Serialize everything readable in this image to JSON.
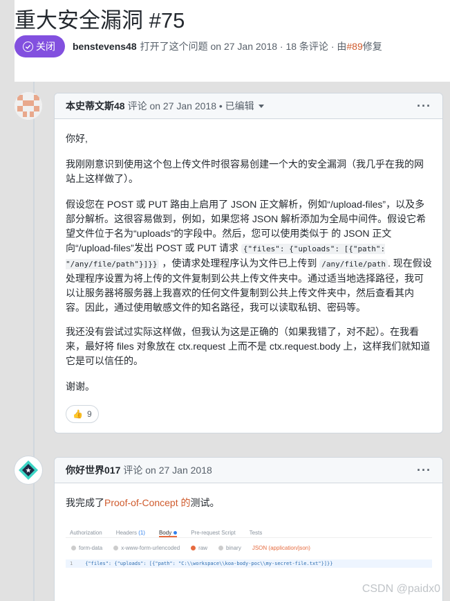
{
  "issue": {
    "title": "重大安全漏洞 #75",
    "state_label": "关闭",
    "author": "benstevens48",
    "opened_text": "打开了这个问题 on 27 Jan 2018 · 18 条评论 · 由",
    "fixed_by": "#89",
    "fixed_suffix": "修复"
  },
  "comments": [
    {
      "author": "本史蒂文斯48",
      "meta": "评论 on 27 Jan 2018 • 已编辑",
      "more": "···",
      "paragraphs": {
        "p1": "你好,",
        "p2": "我刚刚意识到使用这个包上传文件时很容易创建一个大的安全漏洞（我几乎在我的网站上这样做了）。",
        "p3_a": "假设您在 POST 或 PUT 路由上启用了 JSON 正文解析，例如“/upload-files”，以及多部分解析。这很容易做到，例如，如果您将 JSON 解析添加为全局中间件。假设它希望文件位于名为“uploads”的字段中。然后，您可以使用类似于 的 JSON 正文向“/upload-files”发出 POST 或 PUT 请求",
        "p3_code1": "{\"files\": {\"uploads\": [{\"path\": \"/any/file/path\"}]}}",
        "p3_b": "，使请求处理程序认为文件已上传到",
        "p3_code2": "/any/file/path",
        "p3_c": ". 现在假设处理程序设置为将上传的文件复制到公共上传文件夹中。通过适当地选择路径，我可以让服务器将服务器上我喜欢的任何文件复制到公共上传文件夹中，然后查看其内容。因此，通过使用敏感文件的知名路径，我可以读取私钥、密码等。",
        "p4": "我还没有尝试过实际这样做，但我认为这是正确的（如果我错了，对不起）。在我看来，最好将 files 对象放在 ctx.request 上而不是 ctx.request.body 上，这样我们就知道它是可以信任的。",
        "p5": "谢谢。"
      },
      "reaction": {
        "emoji": "👍",
        "count": "9"
      }
    },
    {
      "author": "你好世界017",
      "meta": "评论 on 27 Jan 2018",
      "more": "···",
      "text_before": "我完成了",
      "link": "Proof-of-Concept 的",
      "text_after": "测试。"
    }
  ],
  "postman": {
    "tabs": [
      "Authorization",
      "Headers",
      "Body",
      "Pre-request Script",
      "Tests"
    ],
    "headers_count": "(1)",
    "options": [
      "form-data",
      "x-www-form-urlencoded",
      "raw",
      "binary"
    ],
    "json_label": "JSON (application/json)",
    "line_number": "1",
    "code": "{\"files\": {\"uploads\": [{\"path\": \"C:\\\\workspace\\\\koa-body-poc\\\\my-secret-file.txt\"}]}}"
  },
  "watermark": "CSDN @paidx0",
  "colors": {
    "closed_purple": "#8250df",
    "link_orange": "#cf5a2c"
  }
}
